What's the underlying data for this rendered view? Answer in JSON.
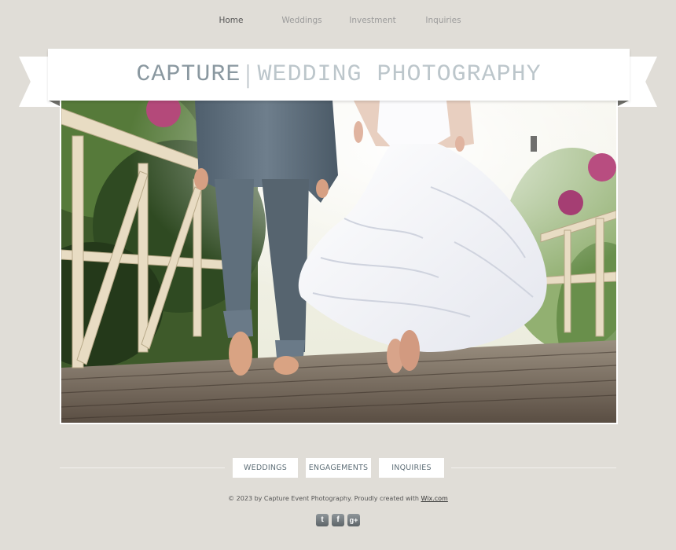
{
  "nav": {
    "items": [
      {
        "label": "Home",
        "active": true
      },
      {
        "label": "Weddings",
        "active": false
      },
      {
        "label": "Investment",
        "active": false
      },
      {
        "label": "Inquiries",
        "active": false
      }
    ]
  },
  "banner": {
    "title_part1": "CAPTURE",
    "separator": "|",
    "title_part2": "WEDDING PHOTOGRAPHY"
  },
  "buttons": {
    "weddings": "WEDDINGS",
    "engagements": "ENGAGEMENTS",
    "inquiries": "INQUIRIES"
  },
  "footer": {
    "copyright_text": "© 2023 by Capture Event Photography. Proudly created with",
    "link_text": "Wix.com"
  },
  "social": [
    {
      "icon": "twitter-icon",
      "glyph": "t"
    },
    {
      "icon": "facebook-icon",
      "glyph": "f"
    },
    {
      "icon": "google-plus-icon",
      "glyph": "g+"
    }
  ],
  "colors": {
    "background": "#e0ddd7",
    "title_primary": "#8a98a0",
    "title_secondary": "#bcc6cb",
    "button_text": "#5f6f78"
  }
}
